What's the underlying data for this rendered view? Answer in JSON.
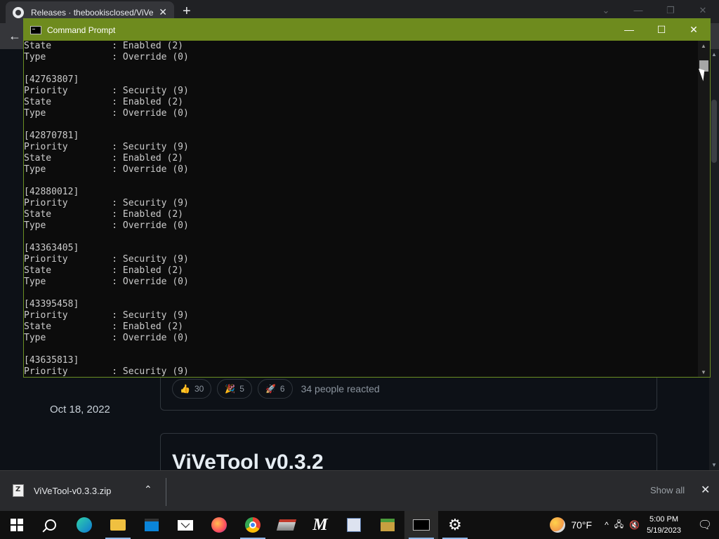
{
  "browser": {
    "tab_title": "Releases · thebookisclosed/ViVe",
    "tab_close": "✕",
    "new_tab": "+",
    "window_controls": [
      "⌄",
      "—",
      "❐",
      "✕"
    ],
    "back": "←"
  },
  "page": {
    "reactions": [
      {
        "emoji": "👍",
        "count": "30"
      },
      {
        "emoji": "🎉",
        "count": "5"
      },
      {
        "emoji": "🚀",
        "count": "6"
      }
    ],
    "reactions_total": "34 people reacted",
    "release_date": "Oct 18, 2022",
    "release_title": "ViVeTool v0.3.2"
  },
  "cmd": {
    "title": "Command Prompt",
    "controls": [
      "—",
      "☐",
      "✕"
    ],
    "lines": [
      "State           : Enabled (2)",
      "Type            : Override (0)",
      "",
      "[42763807]",
      "Priority        : Security (9)",
      "State           : Enabled (2)",
      "Type            : Override (0)",
      "",
      "[42870781]",
      "Priority        : Security (9)",
      "State           : Enabled (2)",
      "Type            : Override (0)",
      "",
      "[42880012]",
      "Priority        : Security (9)",
      "State           : Enabled (2)",
      "Type            : Override (0)",
      "",
      "[43363405]",
      "Priority        : Security (9)",
      "State           : Enabled (2)",
      "Type            : Override (0)",
      "",
      "[43395458]",
      "Priority        : Security (9)",
      "State           : Enabled (2)",
      "Type            : Override (0)",
      "",
      "[43635813]",
      "Priority        : Security (9)"
    ]
  },
  "download_bar": {
    "file_name": "ViVeTool-v0.3.3.zip",
    "chevron": "⌃",
    "show_all": "Show all",
    "close": "✕"
  },
  "taskbar": {
    "apps": [
      "start-icon",
      "search-icon",
      "edge-icon",
      "file-explorer-icon",
      "store-icon",
      "mail-icon",
      "firefox-icon",
      "chrome-icon",
      "app-icon",
      "m-app-icon",
      "app-icon-2",
      "app-icon-3",
      "terminal-icon",
      "settings-icon"
    ],
    "m_label": "M",
    "weather_temp": "70°F",
    "tray_chevron": "^",
    "clock_time": "5:00 PM",
    "clock_date": "5/19/2023",
    "notification": "🗨"
  }
}
